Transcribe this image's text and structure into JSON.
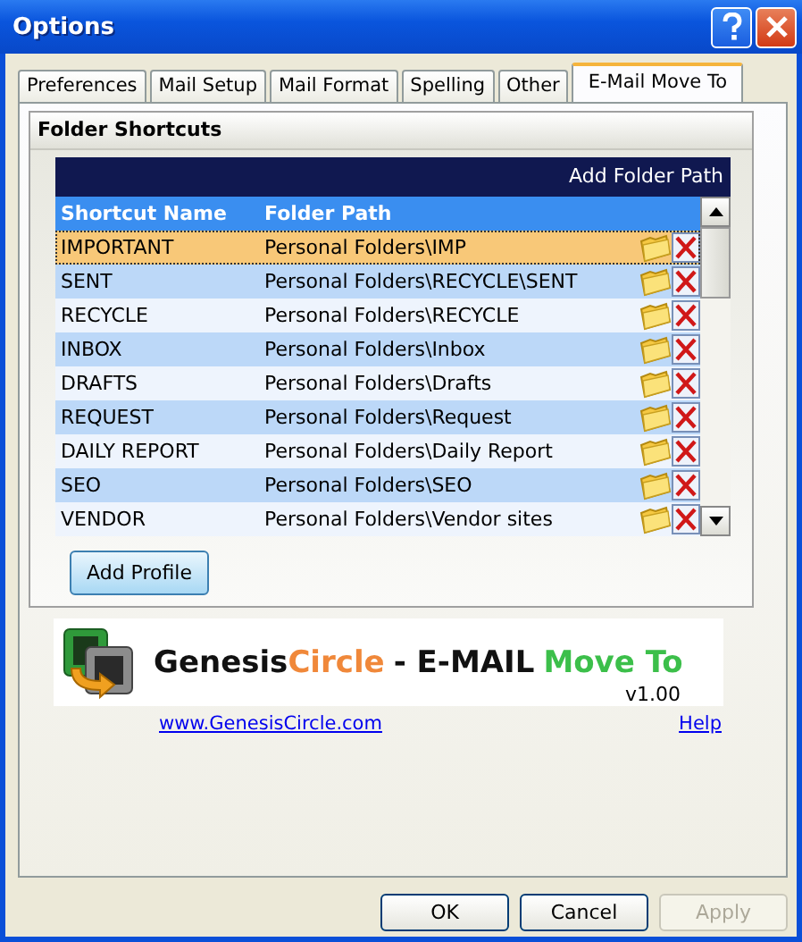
{
  "window": {
    "title": "Options"
  },
  "tabs": [
    {
      "label": "Preferences",
      "selected": false
    },
    {
      "label": "Mail Setup",
      "selected": false
    },
    {
      "label": "Mail Format",
      "selected": false
    },
    {
      "label": "Spelling",
      "selected": false
    },
    {
      "label": "Other",
      "selected": false
    },
    {
      "label": "E-Mail Move To",
      "selected": true
    }
  ],
  "group": {
    "title": "Folder Shortcuts",
    "grid": {
      "header_action": "Add Folder Path",
      "columns": [
        "Shortcut Name",
        "Folder Path"
      ],
      "rows": [
        {
          "name": "IMPORTANT",
          "path": "Personal Folders\\IMP",
          "selected": true
        },
        {
          "name": "SENT",
          "path": "Personal Folders\\RECYCLE\\SENT",
          "selected": false
        },
        {
          "name": "RECYCLE",
          "path": "Personal Folders\\RECYCLE",
          "selected": false
        },
        {
          "name": "INBOX",
          "path": "Personal Folders\\Inbox",
          "selected": false
        },
        {
          "name": "DRAFTS",
          "path": "Personal Folders\\Drafts",
          "selected": false
        },
        {
          "name": "REQUEST",
          "path": "Personal Folders\\Request",
          "selected": false
        },
        {
          "name": "DAILY REPORT",
          "path": "Personal Folders\\Daily Report",
          "selected": false
        },
        {
          "name": "SEO",
          "path": "Personal Folders\\SEO",
          "selected": false
        },
        {
          "name": "VENDOR",
          "path": "Personal Folders\\Vendor sites",
          "selected": false
        }
      ]
    },
    "add_button": "Add Profile"
  },
  "banner": {
    "parts": [
      {
        "text": "Genesis",
        "color": "#111111"
      },
      {
        "text": "Circle",
        "color": "#f0883a"
      },
      {
        "text": "- E-MAIL",
        "color": "#111111"
      },
      {
        "text": "Move To",
        "color": "#3cbf4a"
      }
    ],
    "version": "v1.00"
  },
  "links": [
    "www.GenesisCircle.com",
    "Help"
  ],
  "buttons": [
    {
      "label": "OK",
      "disabled": false
    },
    {
      "label": "Cancel",
      "disabled": false
    },
    {
      "label": "Apply",
      "disabled": true
    }
  ]
}
